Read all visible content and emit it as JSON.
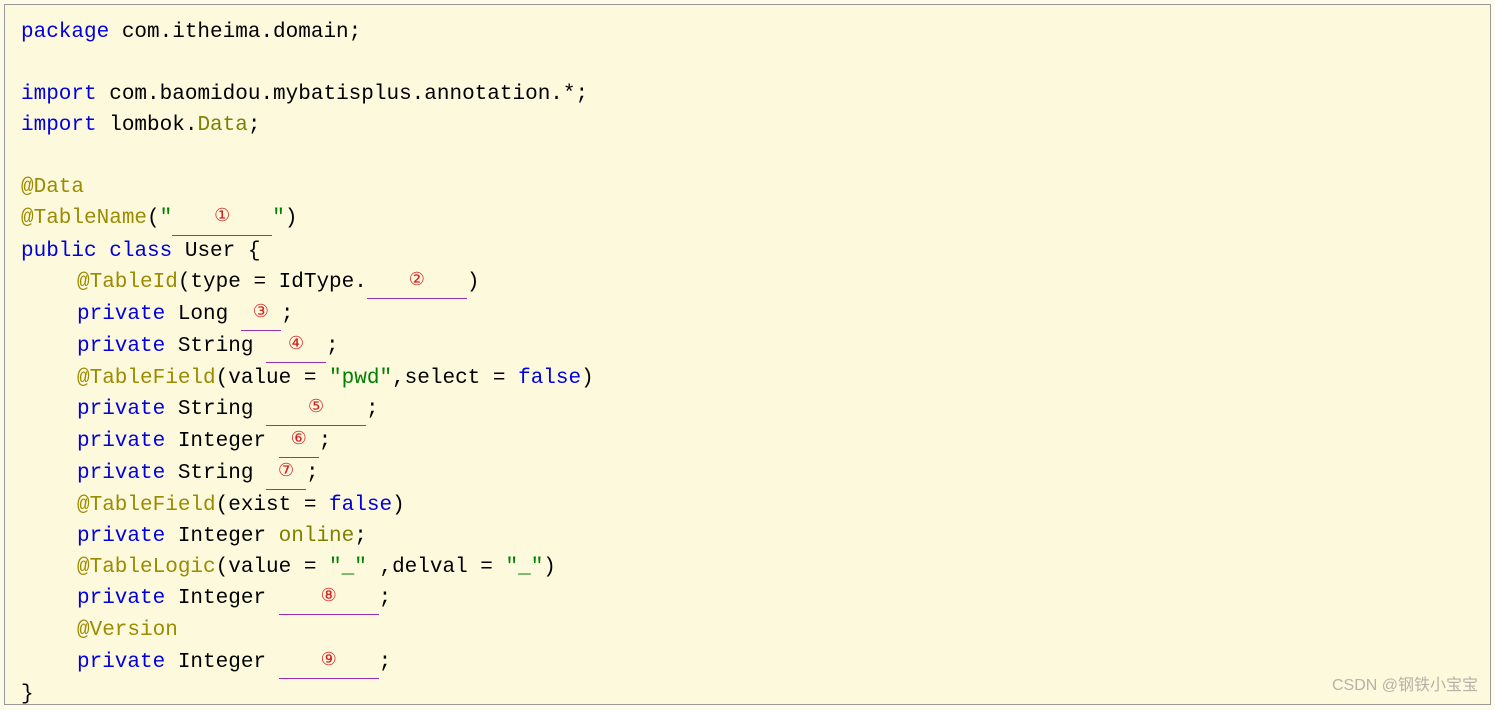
{
  "code": {
    "l1_kw": "package",
    "l1_pkg": " com.itheima.domain;",
    "l2_kw": "import",
    "l2_pkg": " com.baomidou.mybatisplus.annotation.*;",
    "l3_kw": "import",
    "l3_pkg1": " lombok.",
    "l3_pkg2": "Data",
    "l3_pkg3": ";",
    "ann_data": "@Data",
    "ann_tn_open": "@TableName",
    "ann_tn_paren": "(",
    "ann_tn_q1": "\"",
    "ann_tn_q2": "\"",
    "ann_tn_close": ")",
    "cls_pub": "public",
    "cls_cls": "class",
    "cls_name": " User {",
    "ann_tid": "@TableId",
    "ann_tid_open": "(type = IdType.",
    "ann_tid_close": ")",
    "priv": "private",
    "t_long": " Long ",
    "t_string": " String ",
    "t_integer": " Integer ",
    "ann_tf1": "@TableField",
    "ann_tf1_open": "(value = ",
    "ann_tf1_str": "\"pwd\"",
    "ann_tf1_mid": ",select = ",
    "ann_tf1_false": "false",
    "ann_tf1_close": ")",
    "ann_tf2": "@TableField",
    "ann_tf2_open": "(exist = ",
    "ann_tf2_false": "false",
    "ann_tf2_close": ")",
    "online": "online",
    "semi": ";",
    "ann_tl": "@TableLogic",
    "ann_tl_open": "(value = ",
    "ann_tl_s1": "\"_\"",
    "ann_tl_mid": " ,delval = ",
    "ann_tl_s2": "\"_\"",
    "ann_tl_close": ")",
    "ann_ver": "@Version",
    "close_brace": "}",
    "semib": ";",
    "c1": "①",
    "c2": "②",
    "c3": "③",
    "c4": "④",
    "c5": "⑤",
    "c6": "⑥",
    "c7": "⑦",
    "c8": "⑧",
    "c9": "⑨"
  },
  "watermark": "CSDN @钢铁小宝宝"
}
